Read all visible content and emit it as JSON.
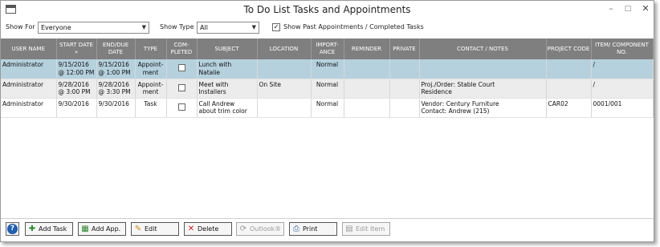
{
  "window": {
    "title": "To Do List Tasks and Appointments"
  },
  "filters": {
    "show_for_label": "Show For",
    "show_for_value": "Everyone",
    "show_type_label": "Show Type",
    "show_type_value": "All",
    "show_past_label": "Show Past Appointments / Completed Tasks",
    "show_past_checked": true
  },
  "table": {
    "headers": [
      "USER NAME",
      "START DATE »",
      "END/DUE DATE",
      "TYPE",
      "COM-PLETED",
      "SUBJECT",
      "LOCATION",
      "IMPORT-ANCE",
      "REMINDER",
      "PRIVATE",
      "CONTACT / NOTES",
      "PROJECT CODE",
      "ITEM/ COMPONENT NO."
    ],
    "rows": [
      {
        "user": "Administrator",
        "start1": "9/15/2016",
        "start2": "@ 12:00 PM",
        "end1": "9/15/2016",
        "end2": "@ 1:00 PM",
        "type1": "Appoint-",
        "type2": "ment",
        "subject1": "Lunch with",
        "subject2": "Natalie",
        "location": "",
        "importance": "Normal",
        "contact1": "",
        "contact2": "",
        "project": "",
        "item": "/"
      },
      {
        "user": "Administrator",
        "start1": "9/28/2016",
        "start2": "@ 3:00 PM",
        "end1": "9/28/2016",
        "end2": "@ 3:30 PM",
        "type1": "Appoint-",
        "type2": "ment",
        "subject1": "Meet with",
        "subject2": "Installers",
        "location": "On Site",
        "importance": "Normal",
        "contact1": "Proj./Order: Stable Court",
        "contact2": "Residence",
        "project": "",
        "item": "/"
      },
      {
        "user": "Administrator",
        "start1": "9/30/2016",
        "start2": "",
        "end1": "9/30/2016",
        "end2": "",
        "type1": "Task",
        "type2": "",
        "subject1": "Call Andrew",
        "subject2": "about trim color",
        "location": "",
        "importance": "Normal",
        "contact1": "Vendor: Century Furniture",
        "contact2": "Contact: Andrew   (215)",
        "project": "CAR02",
        "item": "0001/001"
      }
    ]
  },
  "footer": {
    "help_label": "?",
    "add_task": "Add Task",
    "add_app": "Add App.",
    "edit": "Edit",
    "delete": "Delete",
    "outlook": "Outlook®",
    "print": "Print",
    "edit_item": "Edit Item"
  },
  "icons": {
    "add_task": "add-task-icon",
    "add_app": "add-appointment-icon",
    "edit": "pencil-icon",
    "delete": "red-x-icon",
    "outlook": "refresh-icon",
    "print": "printer-icon",
    "edit_item": "edit-item-icon"
  }
}
